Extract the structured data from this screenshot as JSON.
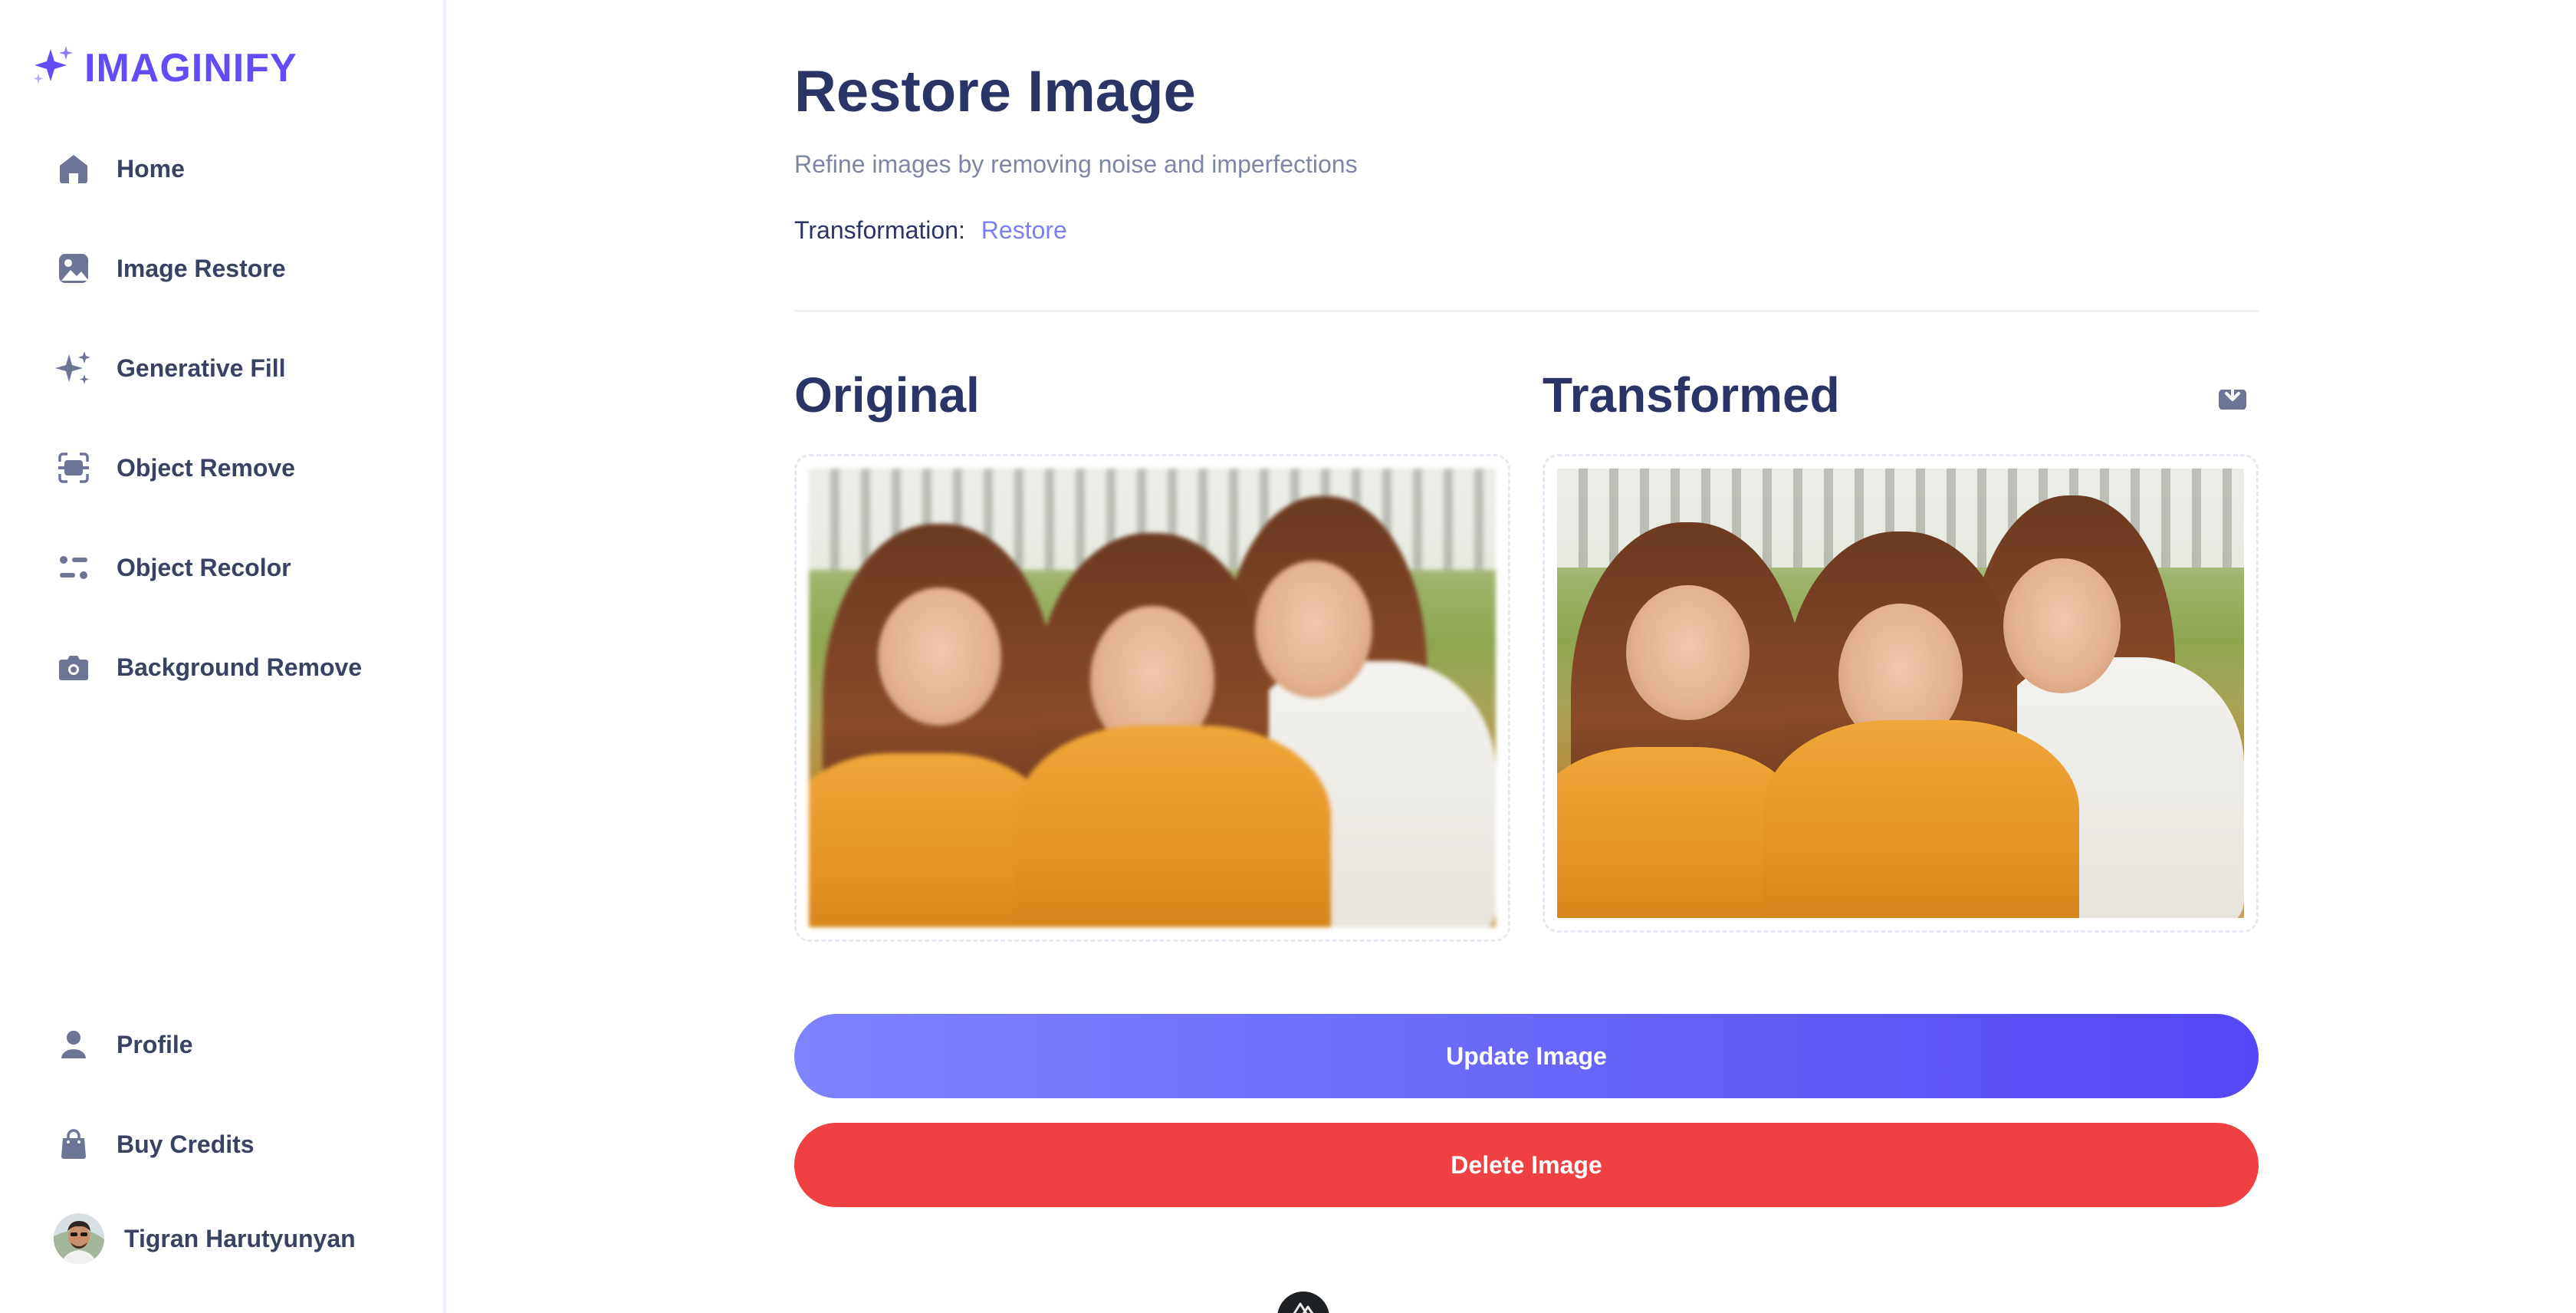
{
  "app": {
    "name": "IMAGINIFY",
    "brand_color": "#624cf5"
  },
  "sidebar": {
    "items": [
      {
        "label": "Home",
        "icon": "home-icon"
      },
      {
        "label": "Image Restore",
        "icon": "image-icon"
      },
      {
        "label": "Generative Fill",
        "icon": "sparkles-icon"
      },
      {
        "label": "Object Remove",
        "icon": "scan-icon"
      },
      {
        "label": "Object Recolor",
        "icon": "filter-icon"
      },
      {
        "label": "Background Remove",
        "icon": "camera-icon"
      }
    ],
    "bottom_items": [
      {
        "label": "Profile",
        "icon": "user-icon"
      },
      {
        "label": "Buy Credits",
        "icon": "bag-icon"
      }
    ],
    "user": {
      "name": "Tigran Harutyunyan"
    }
  },
  "main": {
    "title": "Restore Image",
    "subtitle": "Refine images by removing noise and imperfections",
    "transformation_label": "Transformation:",
    "transformation_value": "Restore",
    "original_title": "Original",
    "transformed_title": "Transformed",
    "update_button": "Update Image",
    "delete_button": "Delete Image"
  },
  "colors": {
    "title": "#2b3467",
    "accent": "#7b7ff0",
    "update_gradient": [
      "#7f82fb",
      "#5546f7"
    ],
    "delete": "#ef4141"
  }
}
